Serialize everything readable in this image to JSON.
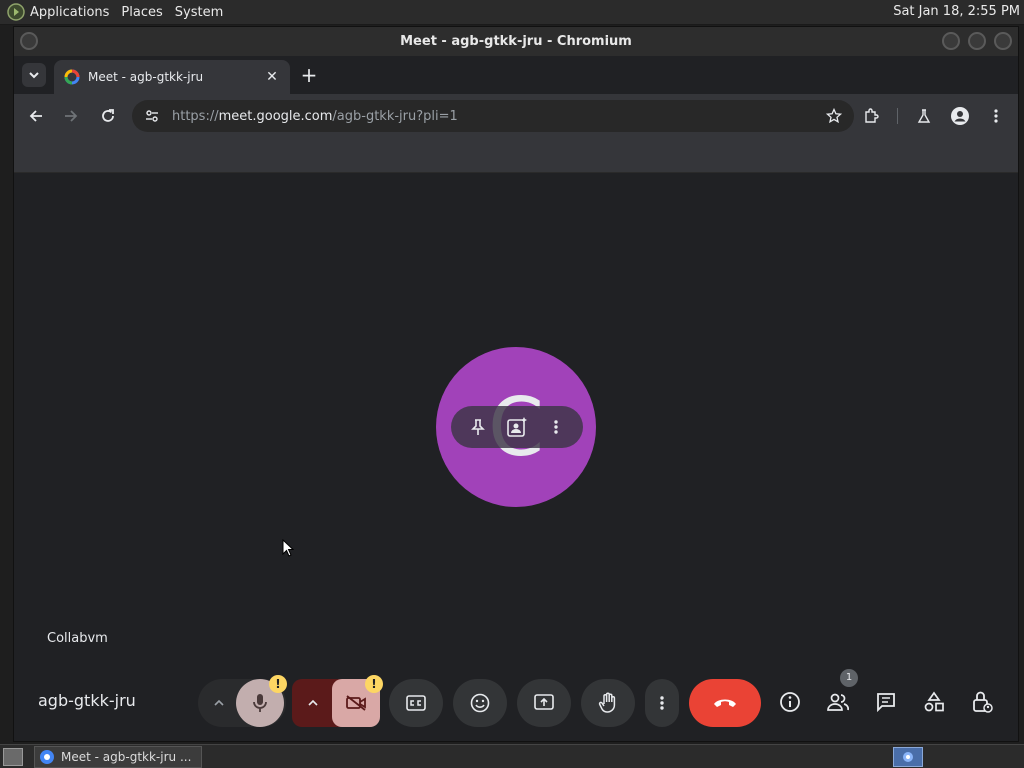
{
  "panel": {
    "menus": [
      "Applications",
      "Places",
      "System"
    ],
    "clock": "Sat Jan 18,  2:55 PM"
  },
  "window": {
    "title": "Meet - agb-gtkk-jru - Chromium"
  },
  "tabs": [
    {
      "title": "Meet - agb-gtkk-jru"
    }
  ],
  "omnibox": {
    "url_prefix": "https://",
    "url_host": "meet.google.com",
    "url_path": "/agb-gtkk-jru?pli=1"
  },
  "meet": {
    "avatar_initial": "C",
    "avatar_color": "#a142b9",
    "participant_name": "Collabvm",
    "meeting_code": "agb-gtkk-jru",
    "people_count": "1",
    "warning_mark": "!",
    "end_call_color": "#ea4335"
  },
  "taskbar": {
    "task_title": "Meet - agb-gtkk-jru ..."
  }
}
